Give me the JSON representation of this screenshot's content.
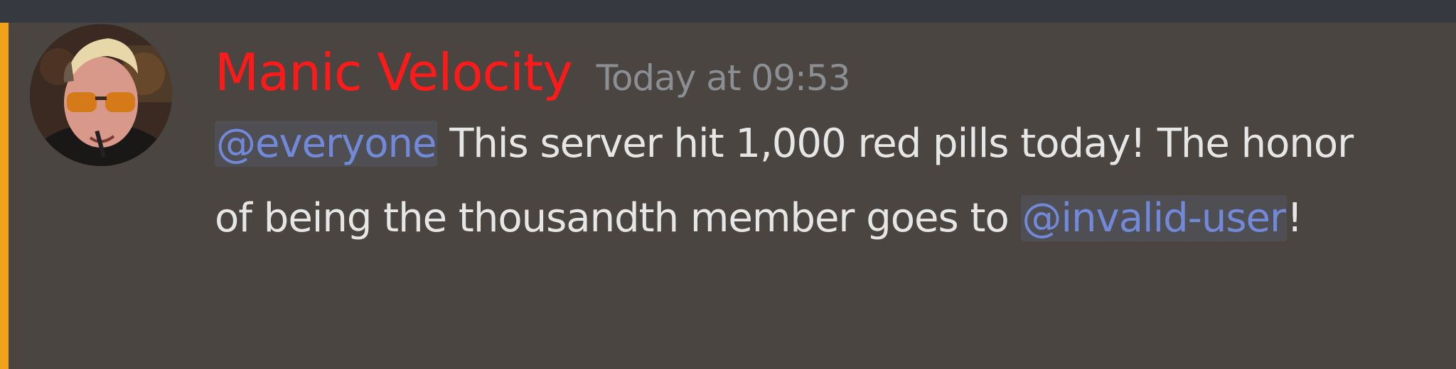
{
  "message": {
    "author": {
      "name": "Manic Velocity",
      "name_color": "#ff1a1a"
    },
    "timestamp": "Today at 09:53",
    "content": {
      "mention_everyone": "@everyone",
      "text_part1": " This server hit 1,000 red pills today! The honor of being the thousandth member goes to ",
      "mention_user": "@invalid-user",
      "text_part2": "!"
    },
    "accent_color": "#f0a21a",
    "mention_color": "#7289da",
    "background_color": "#4a4540"
  }
}
